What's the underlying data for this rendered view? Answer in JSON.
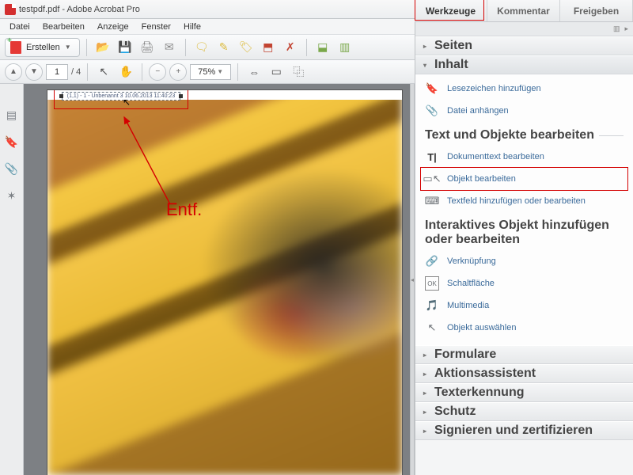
{
  "title": "testpdf.pdf - Adobe Acrobat Pro",
  "menu": {
    "file": "Datei",
    "edit": "Bearbeiten",
    "view": "Anzeige",
    "window": "Fenster",
    "help": "Hilfe"
  },
  "toolbar": {
    "create": "Erstellen",
    "page_current": "1",
    "page_total": "/ 4",
    "zoom": "75%"
  },
  "doc": {
    "header_text": "(1,1) - 1 - Unbenannt 3 10.06.2013 11:40:23"
  },
  "annotation": {
    "label": "Entf."
  },
  "tabs": {
    "tools": "Werkzeuge",
    "comment": "Kommentar",
    "share": "Freigeben"
  },
  "panel": {
    "pages": "Seiten",
    "content": "Inhalt",
    "content_items": {
      "add_bookmark": "Lesezeichen hinzufügen",
      "attach_file": "Datei anhängen",
      "sub_text_objects": "Text und Objekte bearbeiten",
      "edit_doc_text": "Dokumenttext bearbeiten",
      "edit_object": "Objekt bearbeiten",
      "edit_textfield": "Textfeld hinzufügen oder bearbeiten",
      "sub_interactive": "Interaktives Objekt hinzufügen oder bearbeiten",
      "link": "Verknüpfung",
      "button": "Schaltfläche",
      "multimedia": "Multimedia",
      "select_object": "Objekt auswählen"
    },
    "forms": "Formulare",
    "action_wizard": "Aktionsassistent",
    "ocr": "Texterkennung",
    "protection": "Schutz",
    "sign": "Signieren und zertifizieren"
  }
}
